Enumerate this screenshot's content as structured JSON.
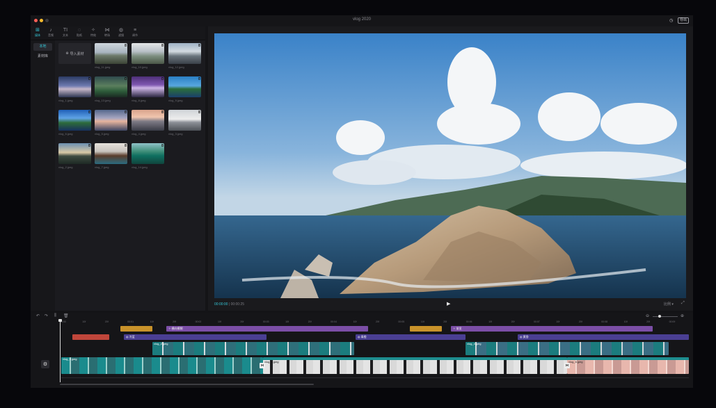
{
  "window": {
    "title": "vlog 2020",
    "export_label": "导出"
  },
  "colors": {
    "accent": "#35c6d6",
    "text_clip": "#c8922a",
    "effect_clip": "#7b4ea6",
    "filter_clip": "#4a3f93",
    "sticker_clip": "#c0463b",
    "video_clip": "#1d8d8f"
  },
  "toolbar": {
    "tools": [
      {
        "icon": "media-icon",
        "glyph": "⊞",
        "label": "媒体"
      },
      {
        "icon": "audio-icon",
        "glyph": "♪",
        "label": "音频"
      },
      {
        "icon": "text-icon",
        "glyph": "TI",
        "label": "文本"
      },
      {
        "icon": "sticker-icon",
        "glyph": "◌",
        "label": "贴纸"
      },
      {
        "icon": "effects-icon",
        "glyph": "✧",
        "label": "特效"
      },
      {
        "icon": "transition-icon",
        "glyph": "⋈",
        "label": "转场"
      },
      {
        "icon": "filter-icon",
        "glyph": "◍",
        "label": "滤镜"
      },
      {
        "icon": "adjust-icon",
        "glyph": "≡",
        "label": "调节"
      }
    ]
  },
  "media_nav": {
    "items": [
      "本地",
      "素材库"
    ]
  },
  "media_grid": {
    "import_label": "导入素材",
    "items": [
      {
        "name": "vlog_11.jpeg"
      },
      {
        "name": "vlog_10.jpeg"
      },
      {
        "name": "vlog_12.jpeg"
      },
      {
        "name": "vlog_1.jpeg"
      },
      {
        "name": "vlog_13.jpeg"
      },
      {
        "name": "vlog_8.jpeg"
      },
      {
        "name": "vlog_9.jpeg"
      },
      {
        "name": "vlog_6.jpeg"
      },
      {
        "name": "vlog_5.jpeg"
      },
      {
        "name": "vlog_4.jpeg"
      },
      {
        "name": "vlog_3.jpeg"
      },
      {
        "name": "vlog_2.jpeg"
      },
      {
        "name": "vlog_7.jpeg"
      },
      {
        "name": "vlog_14.jpeg"
      }
    ]
  },
  "player": {
    "current_time": "00:00:00",
    "total_time": "00:00:25",
    "ratio_label": "比例",
    "play_icon": "play-icon"
  },
  "timeline": {
    "ruler_ticks": [
      "00:00",
      "10f",
      "20f",
      "00:01",
      "10f",
      "20f",
      "00:02",
      "10f",
      "20f",
      "00:03",
      "10f",
      "20f",
      "00:04",
      "10f",
      "20f",
      "00:05",
      "10f",
      "20f",
      "00:06",
      "10f",
      "20f",
      "00:07",
      "10f",
      "20f",
      "00:08",
      "10f",
      "20f",
      "00:09"
    ],
    "effect_clips": [
      "",
      "横向模糊",
      "",
      "渐显"
    ],
    "sticker_clip": "",
    "filter_clips": [
      "冷蓝",
      "青橙",
      "黄昏"
    ],
    "overlay_clips": [
      "vlog_2.jpeg",
      "vlog_4.jpeg"
    ],
    "main_clips": [
      "vlog_9.jpeg",
      "vlog_8.jpeg",
      "vlog_6.jpeg"
    ],
    "cover_label": "封面"
  }
}
